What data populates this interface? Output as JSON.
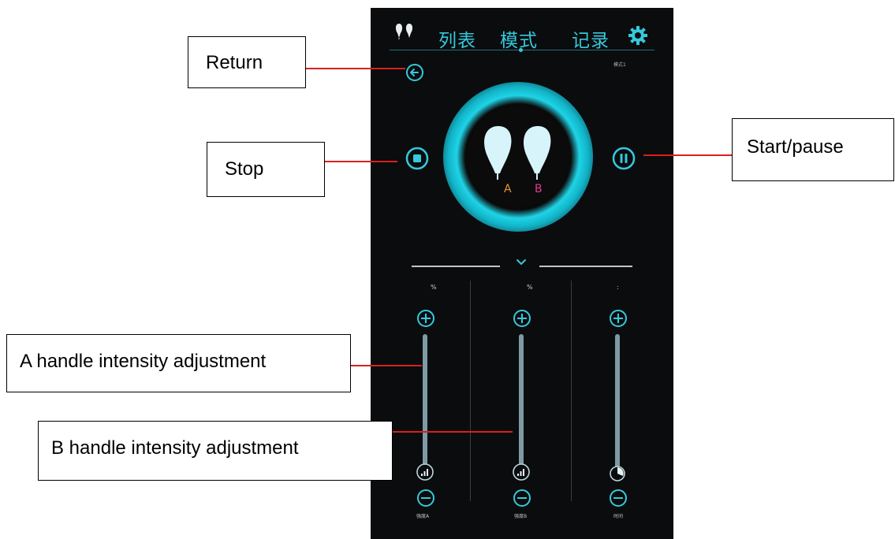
{
  "tabs": [
    {
      "label": "列表"
    },
    {
      "label": "模式"
    },
    {
      "label": "记录"
    }
  ],
  "mode_label": "模式1",
  "handle_letters": {
    "a": "A",
    "b": "B"
  },
  "columns": [
    {
      "head": "%",
      "footer": "强度A",
      "level": 0.0
    },
    {
      "head": "%",
      "footer": "强度B",
      "level": 0.0
    },
    {
      "head": ":",
      "footer": "时间",
      "level": 0.0
    }
  ],
  "colors": {
    "accent": "#35c9dc",
    "handle_a": "#e59a36",
    "handle_b": "#e0398f",
    "leader": "#d8201f"
  },
  "icons": [
    "handles-icon",
    "gear-icon",
    "back-arrow-icon",
    "stop-icon",
    "pause-icon",
    "chevron-down-icon",
    "plus-icon",
    "minus-icon",
    "signal-icon",
    "timer-icon"
  ],
  "annotations": {
    "return": "Return",
    "stop": "Stop",
    "start_pause": "Start/pause",
    "a_intensity": "A handle intensity adjustment",
    "b_intensity": "B handle intensity adjustment"
  }
}
